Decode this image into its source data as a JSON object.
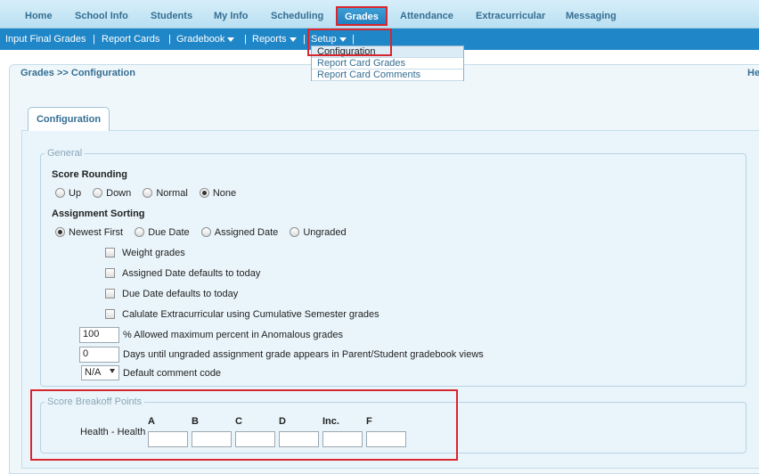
{
  "topnav": {
    "items": [
      "Home",
      "School Info",
      "Students",
      "My Info",
      "Scheduling",
      "Grades",
      "Attendance",
      "Extracurricular",
      "Messaging"
    ],
    "active": "Grades"
  },
  "subnav": {
    "items": [
      "Input Final Grades",
      "Report Cards",
      "Gradebook",
      "Reports",
      "Setup"
    ],
    "separator": "|"
  },
  "dropdown": {
    "items": [
      "Configuration",
      "Report Card Grades",
      "Report Card Comments"
    ],
    "active": "Configuration"
  },
  "breadcrumb": "Grades >> Configuration",
  "help_label": "He",
  "tab_label": "Configuration",
  "general": {
    "legend": "General",
    "score_rounding_label": "Score Rounding",
    "score_rounding_options": [
      "Up",
      "Down",
      "Normal",
      "None"
    ],
    "score_rounding_selected": "None",
    "assignment_sorting_label": "Assignment Sorting",
    "assignment_sorting_options": [
      "Newest First",
      "Due Date",
      "Assigned Date",
      "Ungraded"
    ],
    "assignment_sorting_selected": "Newest First",
    "checkboxes": [
      "Weight grades",
      "Assigned Date defaults to today",
      "Due Date defaults to today",
      "Calulate Extracurricular using Cumulative Semester grades"
    ],
    "allowed_max_value": "100",
    "allowed_max_label": "% Allowed maximum percent in Anomalous grades",
    "days_value": "0",
    "days_label": "Days until ungraded assignment grade appears in Parent/Student gradebook views",
    "comment_code_value": "N/A",
    "comment_code_label": "Default comment code"
  },
  "score_breakoff": {
    "legend": "Score Breakoff Points",
    "row_label": "Health - Health",
    "grades": [
      "A",
      "B",
      "C",
      "D",
      "Inc.",
      "F"
    ]
  }
}
